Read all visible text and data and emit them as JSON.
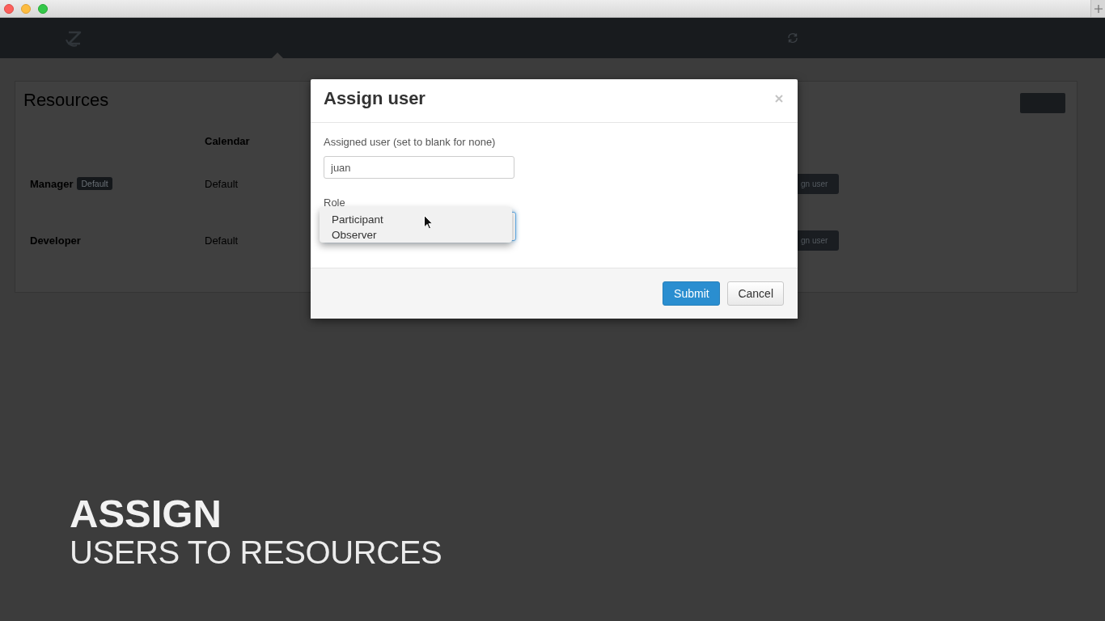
{
  "page": {
    "title": "Resources"
  },
  "table": {
    "columns": [
      "Calendar"
    ],
    "rows": [
      {
        "name": "Manager",
        "badge": "Default",
        "calendar": "Default",
        "action": "gn user"
      },
      {
        "name": "Developer",
        "calendar": "Default",
        "action": "gn user"
      }
    ]
  },
  "dialog": {
    "title": "Assign user",
    "fields": [
      {
        "kind": "text",
        "label": "Assigned user (set to blank for none)",
        "value": "juan"
      },
      {
        "kind": "select",
        "label": "Role",
        "focused": true,
        "open": true,
        "options": [
          {
            "label": "Participant",
            "selected": false
          },
          {
            "label": "Observer",
            "selected": false
          }
        ]
      }
    ],
    "buttons": [
      {
        "kind": "primary",
        "label": "Submit"
      },
      {
        "kind": "default",
        "label": "Cancel"
      }
    ]
  },
  "caption": {
    "title": "ASSIGN",
    "subtitle": "USERS TO RESOURCES"
  }
}
